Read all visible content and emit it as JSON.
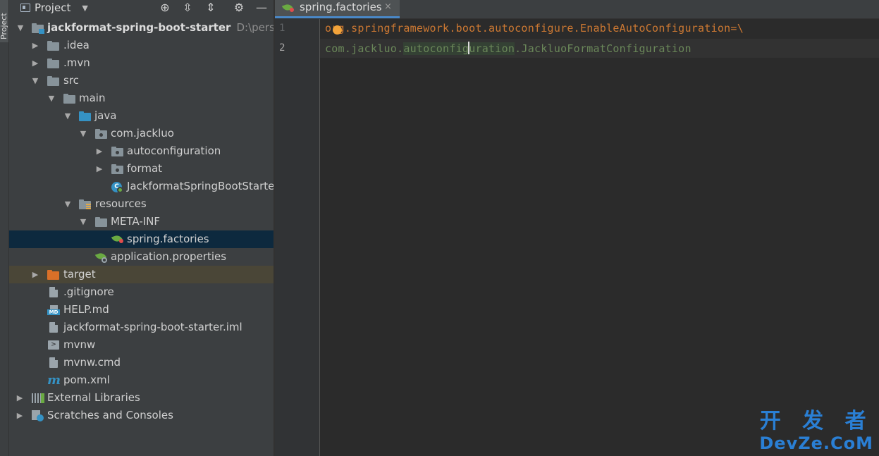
{
  "sidebar": {
    "vertical_tab": "Project"
  },
  "project_panel": {
    "title": "Project",
    "header_icons": [
      "locate-icon",
      "expand-all-icon",
      "collapse-all-icon",
      "settings-icon",
      "hide-icon"
    ]
  },
  "tree": {
    "root": {
      "label": "jackformat-spring-boot-starter",
      "path": "D:\\persona"
    },
    "idea": ".idea",
    "mvn": ".mvn",
    "src": "src",
    "main": "main",
    "java": "java",
    "pkg": "com.jackluo",
    "autoconfiguration": "autoconfiguration",
    "format": "format",
    "app_class": "JackformatSpringBootStarterApplication",
    "resources": "resources",
    "meta_inf": "META-INF",
    "spring_factories": "spring.factories",
    "app_props": "application.properties",
    "target": "target",
    "gitignore": ".gitignore",
    "help": "HELP.md",
    "iml": "jackformat-spring-boot-starter.iml",
    "mvnw": "mvnw",
    "mvnw_cmd": "mvnw.cmd",
    "pom": "pom.xml",
    "ext_libs": "External Libraries",
    "scratches": "Scratches and Consoles"
  },
  "editor": {
    "tab_label": "spring.factories",
    "close_glyph": "×",
    "line_numbers": [
      "1",
      "2"
    ],
    "line1": "org.springframework.boot.autoconfigure.EnableAutoConfiguration=\\",
    "line2": {
      "p1": "com.",
      "p2": "jackluo",
      "p3": ".",
      "p4": "autoconfig",
      "p5": "uration",
      "p6": ".",
      "p7": "JackluoFormatConfiguration"
    }
  },
  "watermark": {
    "cn": "开 发 者",
    "en": "DevZe.CoM"
  },
  "colors": {
    "keyword": "#cc7832",
    "string": "#6a8759",
    "selection": "#0d293e",
    "accent": "#4a88c7"
  }
}
